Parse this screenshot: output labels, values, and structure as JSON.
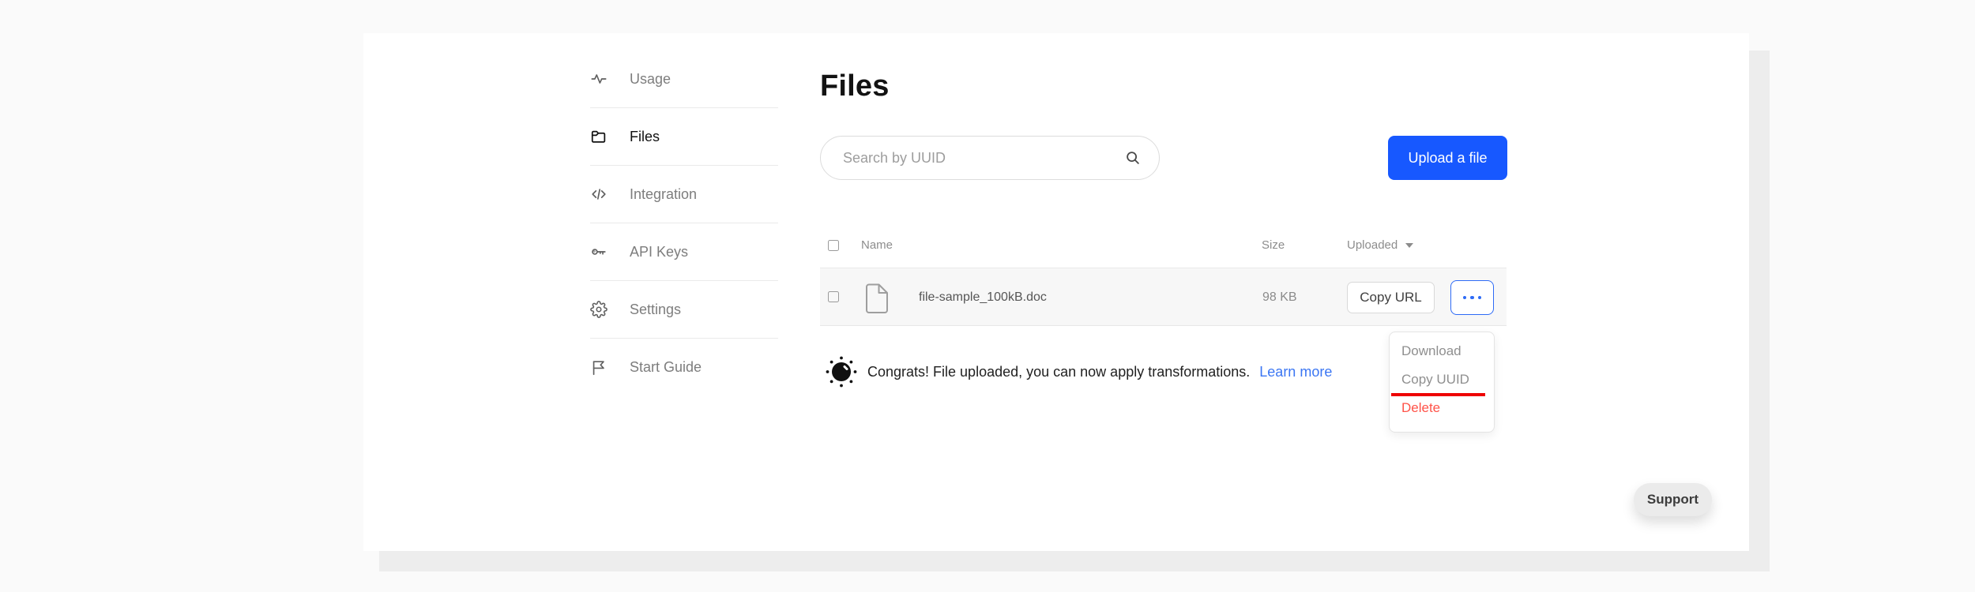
{
  "sidebar": {
    "items": [
      {
        "label": "Usage",
        "icon": "activity-icon",
        "active": false
      },
      {
        "label": "Files",
        "icon": "folder-icon",
        "active": true
      },
      {
        "label": "Integration",
        "icon": "code-icon",
        "active": false
      },
      {
        "label": "API Keys",
        "icon": "key-icon",
        "active": false
      },
      {
        "label": "Settings",
        "icon": "gear-icon",
        "active": false
      },
      {
        "label": "Start Guide",
        "icon": "flag-icon",
        "active": false
      }
    ]
  },
  "header": {
    "title": "Files"
  },
  "search": {
    "placeholder": "Search by UUID",
    "icon": "search-icon"
  },
  "upload_button": {
    "label": "Upload a file"
  },
  "table": {
    "columns": [
      "Name",
      "Size",
      "Uploaded"
    ],
    "sort_column": "Uploaded",
    "rows": [
      {
        "name": "file-sample_100kB.doc",
        "size": "98 KB"
      }
    ],
    "row_actions": {
      "copy_url": "Copy URL",
      "more": "ellipsis"
    }
  },
  "menu": {
    "items": [
      {
        "label": "Download",
        "danger": false,
        "underlined": false
      },
      {
        "label": "Copy UUID",
        "danger": false,
        "underlined": true
      },
      {
        "label": "Delete",
        "danger": true,
        "underlined": false
      }
    ]
  },
  "banner": {
    "icon": "firework-icon",
    "text": "Congrats! File uploaded, you can now apply transformations.",
    "link_label": "Learn more"
  },
  "support": {
    "label": "Support"
  },
  "colors": {
    "accent_blue": "#1758ff",
    "more_button_blue": "#2e6bf6",
    "link_blue": "#3b76f3",
    "danger_red": "#ff5349",
    "annotation_red": "#ee0000",
    "page_background": "#fafafa",
    "card_background": "#ffffff",
    "behind_card": "#ededed",
    "row_background": "#f7f7f7"
  }
}
